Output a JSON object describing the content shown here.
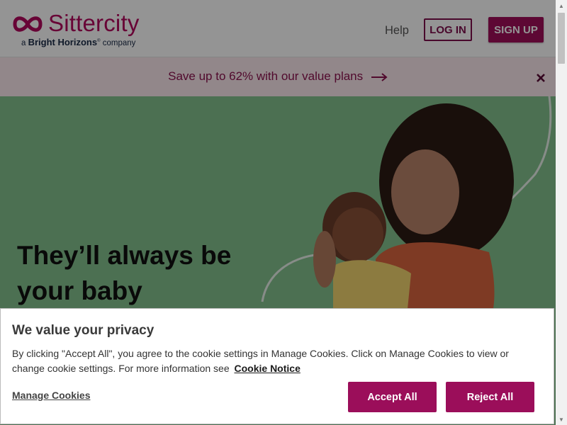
{
  "brand": {
    "name": "Sittercity",
    "tagline_prefix": "a ",
    "tagline_brand": "Bright Horizons",
    "tagline_suffix": "company",
    "color": "#b3075e"
  },
  "header": {
    "help_label": "Help",
    "login_label": "LOG IN",
    "signup_label": "SIGN UP"
  },
  "promo": {
    "text": "Save up to 62% with our value plans",
    "arrow_icon": "arrow-right-icon",
    "close_icon": "close-icon"
  },
  "hero": {
    "title_line1": "They’ll always be",
    "title_line2": "your baby",
    "background_color": "#84c18e"
  },
  "cookie_banner": {
    "title": "We value your privacy",
    "text": "By clicking \"Accept All\", you agree to the cookie settings in Manage Cookies. Click on Manage Cookies to view or change cookie settings. For more information see",
    "notice_link": "Cookie Notice",
    "manage_label": "Manage Cookies",
    "accept_label": "Accept All",
    "reject_label": "Reject All",
    "button_color": "#9b0e5a"
  }
}
